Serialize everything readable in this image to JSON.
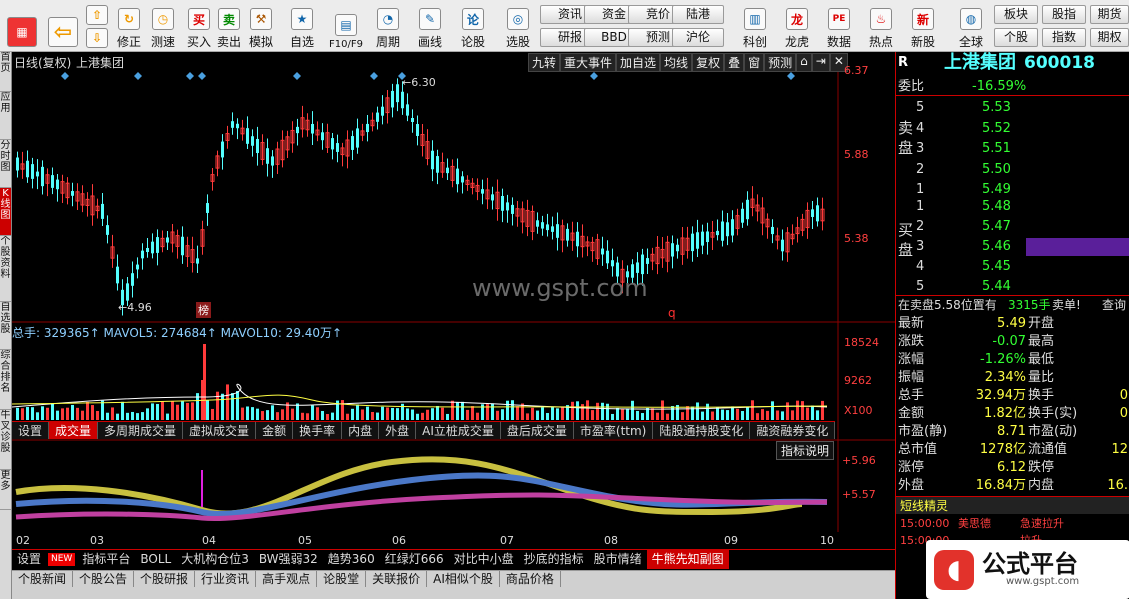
{
  "toolbar": {
    "buttons": [
      "修正",
      "测速",
      "买入",
      "卖出",
      "模拟",
      "自选",
      "F10/F9",
      "周期",
      "画线",
      "论股",
      "选股",
      "科创",
      "龙虎",
      "数据",
      "热点",
      "新股",
      "全球"
    ],
    "small": [
      "资讯",
      "资金",
      "竞价",
      "陆港",
      "研报",
      "BBD",
      "预测",
      "沪伦",
      "板块",
      "股指",
      "期货",
      "个股",
      "指数",
      "期权"
    ]
  },
  "vtabs": [
    "首页",
    "应用",
    "分时图",
    "K线图",
    "个股资料",
    "自选股",
    "综合排名",
    "牛叉诊股",
    "更多"
  ],
  "chart": {
    "header_left": "日线(复权)",
    "stock_name": "上港集团",
    "price_high_label": "6.30",
    "price_low_label": "4.96",
    "right_buttons": [
      "九转",
      "重大事件",
      "加自选",
      "均线",
      "复权",
      "叠",
      "窗",
      "预测"
    ],
    "yticks": [
      "6.37",
      "5.88",
      "5.38"
    ],
    "badge": "榜",
    "marker_q": "q",
    "watermark": "www.gspt.com"
  },
  "volume": {
    "label": "总手: 329365↑ MAVOL5: 274684↑ MAVOL10: 29.40万↑",
    "yticks": [
      "18524",
      "9262",
      "X100"
    ]
  },
  "indtabs": [
    "设置",
    "成交量",
    "多周期成交量",
    "虚拟成交量",
    "金额",
    "换手率",
    "内盘",
    "外盘",
    "AI立桩成交量",
    "盘后成交量",
    "市盈率(ttm)",
    "陆股通持股变化",
    "融资融券变化"
  ],
  "lowerind": {
    "button": "指标说明",
    "yticks": [
      "+5.96",
      "+5.57"
    ],
    "months": [
      "02",
      "03",
      "04",
      "05",
      "06",
      "07",
      "08",
      "09",
      "10"
    ]
  },
  "bottomtabs": [
    "设置",
    "NEW",
    "指标平台",
    "BOLL",
    "大机构仓位3",
    "BW强弱32",
    "趋势360",
    "红绿灯666",
    "对比中小盘",
    "抄底的指标",
    "股市情绪",
    "牛熊先知副图"
  ],
  "newstabs": [
    "个股新闻",
    "个股公告",
    "个股研报",
    "行业资讯",
    "高手观点",
    "论股堂",
    "关联报价",
    "AI相似个股",
    "商品价格"
  ],
  "panel": {
    "top_r": "R",
    "name": "上港集团",
    "code": "600018",
    "weibi_label": "委比",
    "weibi": "-16.59%",
    "sell_label": [
      "卖",
      "盘"
    ],
    "buy_label": [
      "买",
      "盘"
    ],
    "sell": [
      [
        "5",
        "5.53"
      ],
      [
        "4",
        "5.52"
      ],
      [
        "3",
        "5.51"
      ],
      [
        "2",
        "5.50"
      ],
      [
        "1",
        "5.49"
      ]
    ],
    "buy": [
      [
        "1",
        "5.48"
      ],
      [
        "2",
        "5.47"
      ],
      [
        "3",
        "5.46"
      ],
      [
        "4",
        "5.45"
      ],
      [
        "5",
        "5.44"
      ]
    ],
    "notice": "在卖盘5.58位置有",
    "notice_qty": "3315手",
    "notice_tail": "卖单!",
    "notice_link": "查询",
    "stats": [
      [
        "最新",
        "5.49",
        "开盘"
      ],
      [
        "涨跌",
        "-0.07",
        "最高"
      ],
      [
        "涨幅",
        "-1.26%",
        "最低"
      ],
      [
        "振幅",
        "2.34%",
        "量比"
      ],
      [
        "总手",
        "32.94万",
        "换手"
      ],
      [
        "金额",
        "1.82亿",
        "换手(实)"
      ],
      [
        "市盈(静)",
        "8.71",
        "市盈(动)"
      ],
      [
        "总市值",
        "1278亿",
        "流通值"
      ],
      [
        "涨停",
        "6.12",
        "跌停"
      ],
      [
        "外盘",
        "16.84万",
        "内盘"
      ]
    ],
    "stats_right": [
      "",
      "",
      "",
      "",
      "0",
      "0",
      "",
      "12",
      "",
      "16."
    ],
    "sprite_title": "短线精灵",
    "sprite": [
      [
        "15:00:00",
        "美思德",
        "急速拉升"
      ],
      [
        "15:00:00",
        "",
        "拉升"
      ]
    ],
    "logo_text": "公式平台",
    "logo_sub": "www.gspt.com"
  },
  "colors": {
    "up": "#ff3b3b",
    "down": "#54ffff",
    "accent": "#c00000"
  }
}
